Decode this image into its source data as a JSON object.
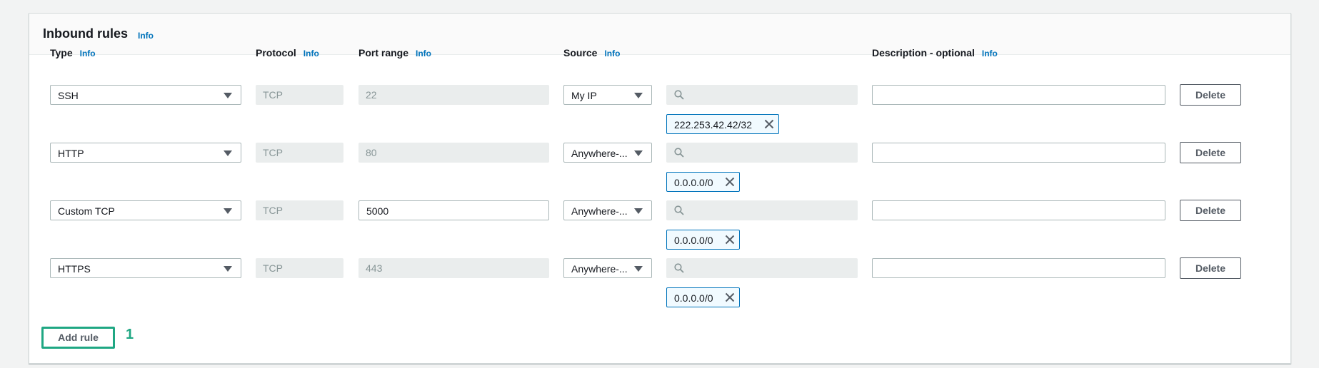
{
  "section": {
    "title": "Inbound rules",
    "title_info": "Info"
  },
  "columns": {
    "type": "Type",
    "protocol": "Protocol",
    "port_range": "Port range",
    "source": "Source",
    "description": "Description - optional",
    "info": "Info"
  },
  "rules": [
    {
      "type": "SSH",
      "protocol": "TCP",
      "port": "22",
      "source": "My IP",
      "cidr": "222.253.42.42/32",
      "description": "",
      "delete_label": "Delete"
    },
    {
      "type": "HTTP",
      "protocol": "TCP",
      "port": "80",
      "source": "Anywhere-...",
      "cidr": "0.0.0.0/0",
      "description": "",
      "delete_label": "Delete"
    },
    {
      "type": "Custom TCP",
      "protocol": "TCP",
      "port": "5000",
      "source": "Anywhere-...",
      "cidr": "0.0.0.0/0",
      "description": "",
      "delete_label": "Delete"
    },
    {
      "type": "HTTPS",
      "protocol": "TCP",
      "port": "443",
      "source": "Anywhere-...",
      "cidr": "0.0.0.0/0",
      "description": "",
      "delete_label": "Delete"
    }
  ],
  "add_rule_label": "Add rule",
  "step_marker": "1",
  "colors": {
    "link": "#0073bb",
    "highlight": "#1fa783",
    "token_border": "#0073bb"
  }
}
